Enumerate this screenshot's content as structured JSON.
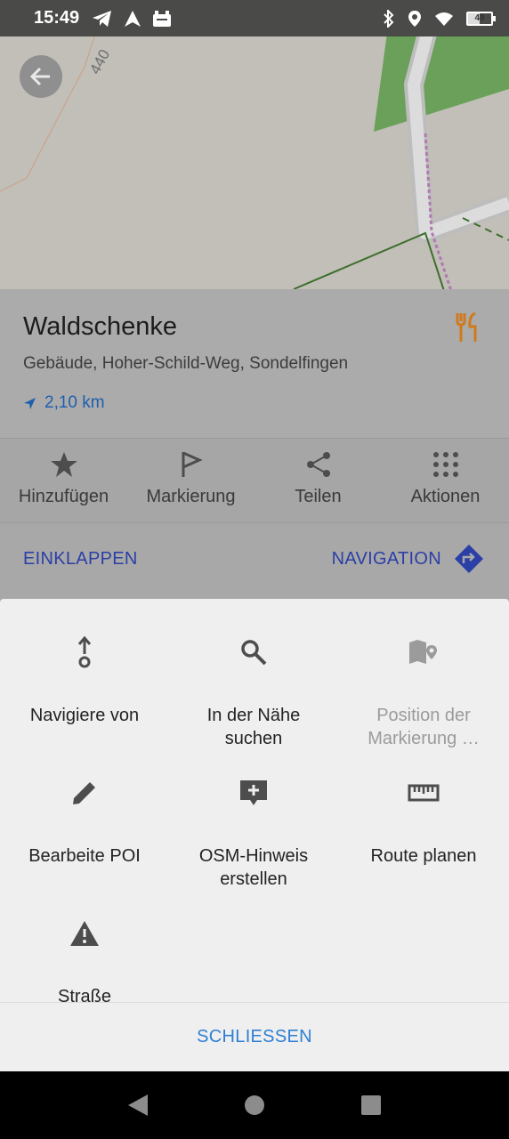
{
  "status_bar": {
    "time": "15:49",
    "battery_level": "49",
    "left_icons": [
      "telegram-icon",
      "navigation-arrow-icon",
      "android-icon"
    ],
    "right_icons": [
      "bluetooth-icon",
      "location-icon",
      "wifi-icon",
      "battery-icon"
    ]
  },
  "map": {
    "elevation_label": "440",
    "road_color": "#d9d9d9",
    "forest_color": "#6aa05a",
    "path_color": "#b07ab0"
  },
  "poi": {
    "title": "Waldschenke",
    "subtitle": "Gebäude, Hoher-Schild-Weg, Sondelfingen",
    "distance": "2,10 km",
    "type_icon": "restaurant-icon",
    "accent_color": "#d17a1c"
  },
  "actions": [
    {
      "label": "Hinzufügen",
      "icon": "star-icon"
    },
    {
      "label": "Markierung",
      "icon": "flag-icon"
    },
    {
      "label": "Teilen",
      "icon": "share-icon"
    },
    {
      "label": "Aktionen",
      "icon": "grid-icon"
    }
  ],
  "bottom_row": {
    "collapse": "EINKLAPPEN",
    "navigation": "NAVIGATION"
  },
  "sheet": {
    "options": [
      {
        "label": "Navigiere von",
        "icon": "navigate-from-icon",
        "enabled": true
      },
      {
        "label": "In der Nähe suchen",
        "icon": "search-icon",
        "enabled": true
      },
      {
        "label": "Position der Markierung …",
        "icon": "map-pin-icon",
        "enabled": false
      },
      {
        "label": "Bearbeite POI",
        "icon": "pencil-icon",
        "enabled": true
      },
      {
        "label": "OSM-Hinweis erstellen",
        "icon": "add-note-icon",
        "enabled": true
      },
      {
        "label": "Route planen",
        "icon": "ruler-icon",
        "enabled": true
      },
      {
        "label": "Straße",
        "icon": "warning-icon",
        "enabled": true
      }
    ],
    "close": "SCHLIESSEN"
  }
}
